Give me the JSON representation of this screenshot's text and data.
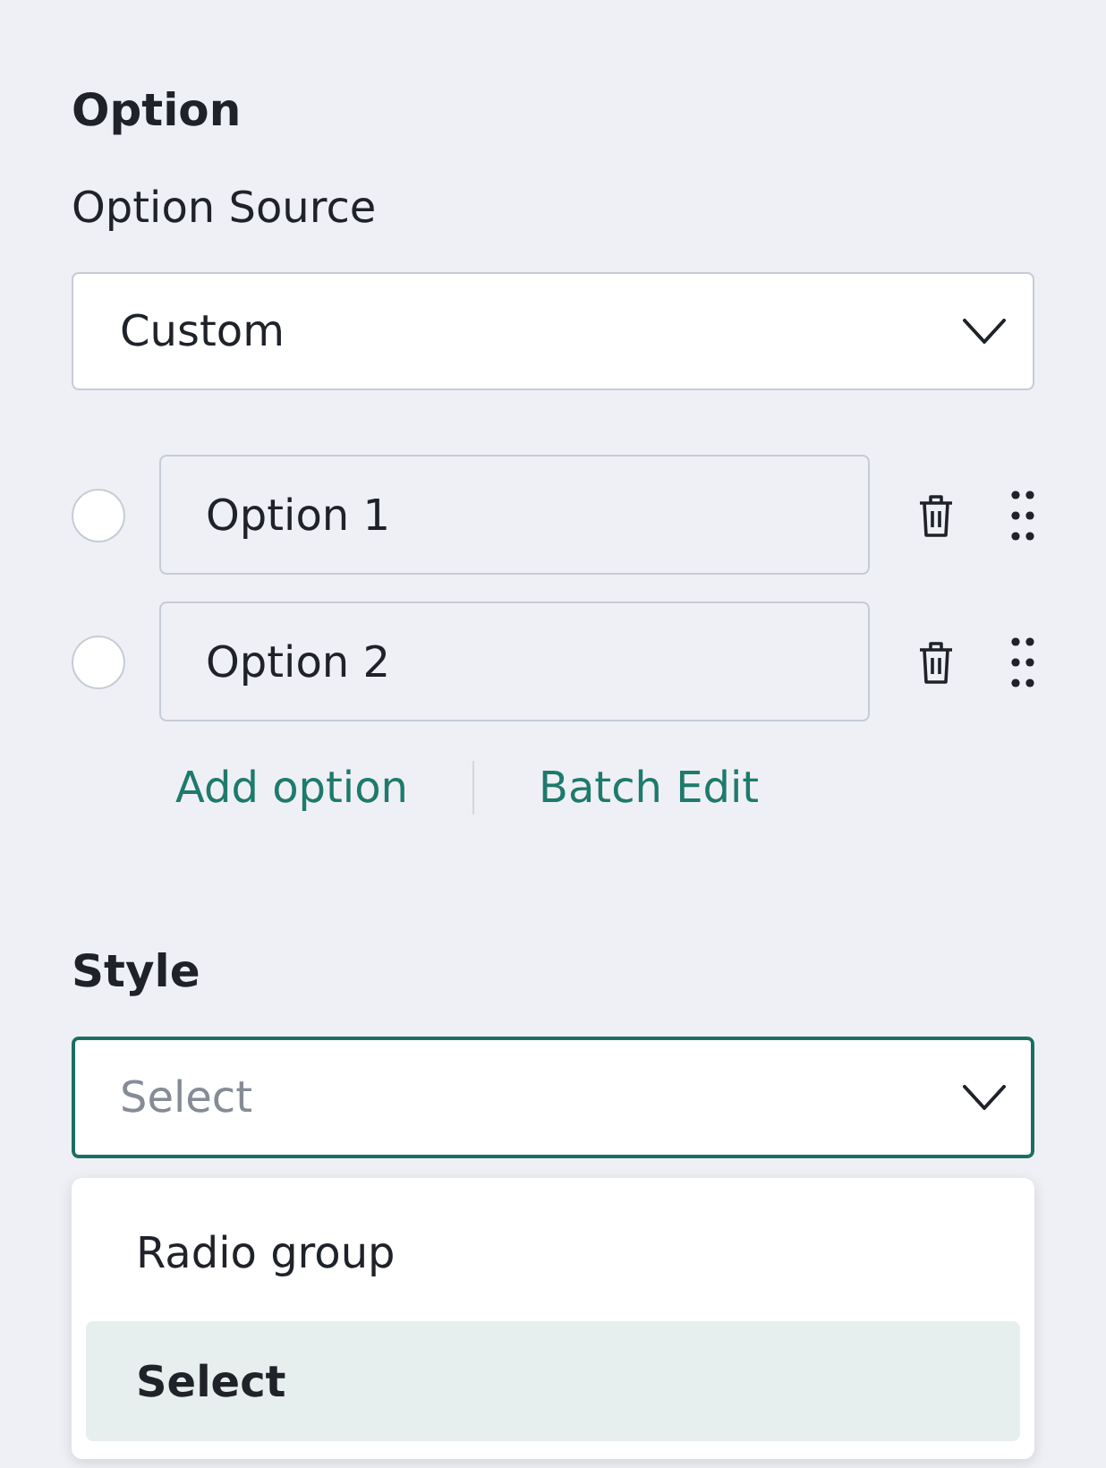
{
  "option_section": {
    "title": "Option",
    "source_label": "Option Source",
    "source_select": {
      "value": "Custom",
      "expanded": false
    },
    "options": [
      {
        "value": "Option 1",
        "checked": false
      },
      {
        "value": "Option 2",
        "checked": false
      }
    ],
    "actions": [
      {
        "label": "Add option"
      },
      {
        "label": "Batch Edit"
      }
    ]
  },
  "style_section": {
    "title": "Style",
    "select": {
      "placeholder": "Select",
      "expanded": true
    },
    "menu": [
      {
        "label": "Radio group",
        "selected": false
      },
      {
        "label": "Select",
        "selected": true
      }
    ]
  }
}
